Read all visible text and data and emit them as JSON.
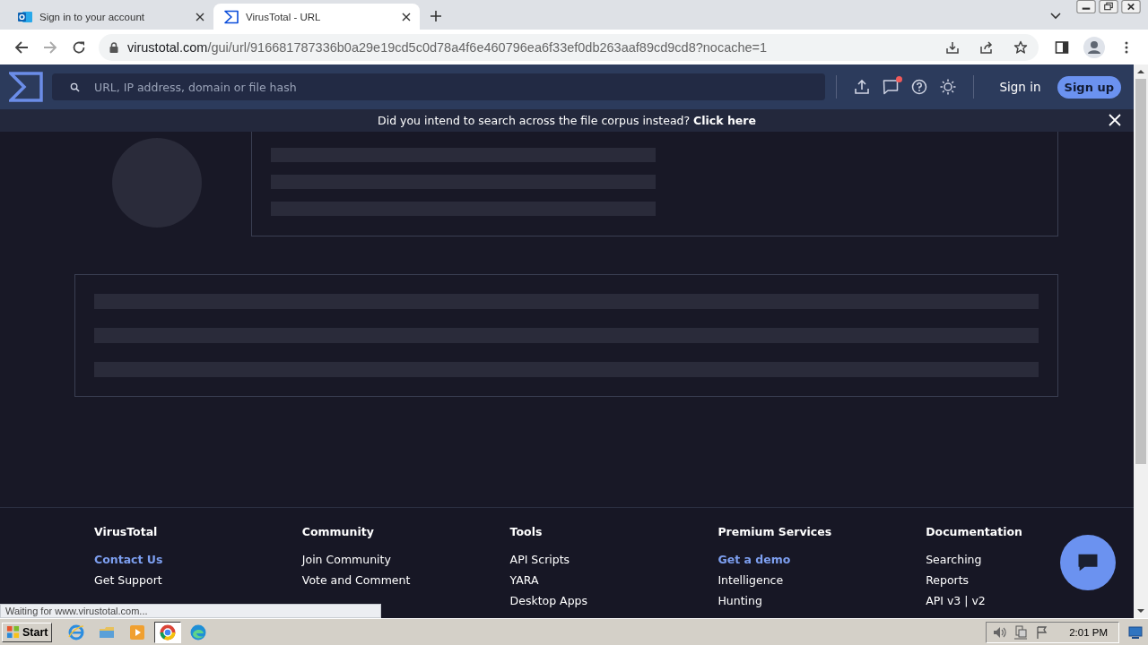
{
  "browser": {
    "tabs": [
      {
        "title": "Sign in to your account",
        "selected": false
      },
      {
        "title": "VirusTotal - URL",
        "selected": true
      }
    ],
    "url_host": "virustotal.com",
    "url_path": "/gui/url/916681787336b0a29e19cd5c0d78a4f6e460796ea6f33ef0db263aaf89cd9cd8?nocache=1"
  },
  "header": {
    "search": {
      "placeholder": "URL, IP address, domain or file hash"
    },
    "notifications_unread": true,
    "sign_in": "Sign in",
    "sign_up": "Sign up"
  },
  "banner": {
    "text": "Did you intend to search across the file corpus instead? **Click here**"
  },
  "footer": {
    "columns": [
      {
        "heading": "VirusTotal",
        "links": [
          {
            "label": "Contact Us",
            "highlighted": true
          },
          {
            "label": "Get Support",
            "highlighted": false
          }
        ]
      },
      {
        "heading": "Community",
        "links": [
          {
            "label": "Join Community",
            "highlighted": false
          },
          {
            "label": "Vote and Comment",
            "highlighted": false
          }
        ]
      },
      {
        "heading": "Tools",
        "links": [
          {
            "label": "API Scripts",
            "highlighted": false
          },
          {
            "label": "YARA",
            "highlighted": false
          },
          {
            "label": "Desktop Apps",
            "highlighted": false
          }
        ]
      },
      {
        "heading": "Premium Services",
        "links": [
          {
            "label": "Get a demo",
            "highlighted": true
          },
          {
            "label": "Intelligence",
            "highlighted": false
          },
          {
            "label": "Hunting",
            "highlighted": false
          }
        ]
      },
      {
        "heading": "Documentation",
        "links": [
          {
            "label": "Searching",
            "highlighted": false
          },
          {
            "label": "Reports",
            "highlighted": false
          },
          {
            "label": "API v3 | v2",
            "highlighted": false
          }
        ]
      }
    ]
  },
  "status_bar": "Waiting for www.virustotal.com...",
  "taskbar": {
    "start": "Start",
    "apps": [
      {
        "selected": false
      },
      {
        "selected": false
      },
      {
        "selected": false
      },
      {
        "selected": true
      },
      {
        "selected": false
      }
    ],
    "clock": "2:01 PM"
  }
}
